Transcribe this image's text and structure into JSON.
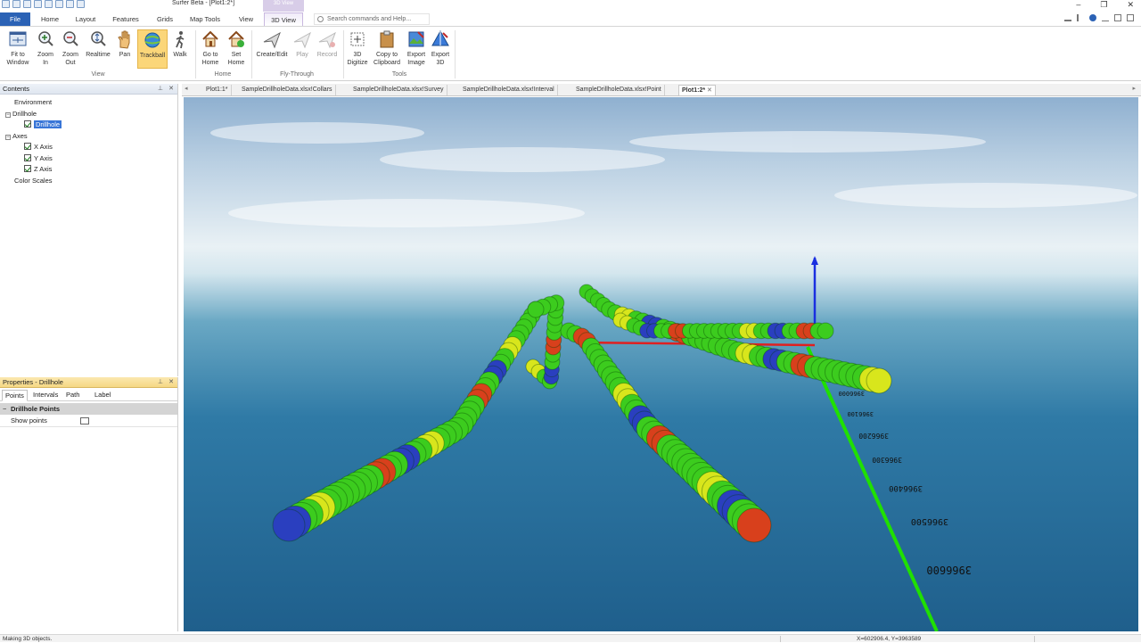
{
  "window": {
    "title": "Surfer Beta - [Plot1:2*]",
    "contextual_tab_header": "3D View"
  },
  "ribbon_tabs": [
    "File",
    "Home",
    "Layout",
    "Features",
    "Grids",
    "Map Tools",
    "View",
    "3D View"
  ],
  "active_tab": "3D View",
  "search": {
    "placeholder": "Search commands and Help..."
  },
  "ribbon": {
    "groups": [
      {
        "label": "View",
        "buttons": [
          "Fit to Window",
          "Zoom In",
          "Zoom Out",
          "Realtime",
          "Pan",
          "Trackball",
          "Walk"
        ]
      },
      {
        "label": "Home",
        "buttons": [
          "Go to Home",
          "Set Home"
        ]
      },
      {
        "label": "Fly-Through",
        "buttons": [
          "Create/Edit",
          "Play",
          "Record"
        ]
      },
      {
        "label": "Tools",
        "buttons": [
          "3D Digitize",
          "Copy to Clipboard",
          "Export Image",
          "Export 3D"
        ]
      }
    ],
    "labels": {
      "fit1": "Fit to",
      "fit2": "Window",
      "zoomin1": "Zoom",
      "zoomin2": "In",
      "zoomout1": "Zoom",
      "zoomout2": "Out",
      "realtime": "Realtime",
      "pan": "Pan",
      "trackball": "Trackball",
      "walk": "Walk",
      "gohome1": "Go to",
      "gohome2": "Home",
      "sethome1": "Set",
      "sethome2": "Home",
      "create": "Create/Edit",
      "play": "Play",
      "record": "Record",
      "dig1": "3D",
      "dig2": "Digitize",
      "copy1": "Copy to",
      "copy2": "Clipboard",
      "expimg1": "Export",
      "expimg2": "Image",
      "exp3d1": "Export",
      "exp3d2": "3D"
    },
    "selected": "Trackball",
    "disabled": [
      "Play",
      "Record"
    ]
  },
  "contents_panel": {
    "title": "Contents",
    "tree": {
      "environment": "Environment",
      "drillhole": "Drillhole",
      "drillhole_child": "Drillhole",
      "axes": "Axes",
      "x_axis": "X Axis",
      "y_axis": "Y Axis",
      "z_axis": "Z Axis",
      "color_scales": "Color Scales"
    }
  },
  "properties_panel": {
    "title": "Properties - Drillhole",
    "tabs": [
      "Points",
      "Intervals",
      "Path",
      "Label"
    ],
    "active_tab": "Points",
    "section": "Drillhole Points",
    "rows": [
      {
        "label": "Show points",
        "checked": false
      }
    ]
  },
  "doc_tabs": [
    "Plot1:1*",
    "SampleDrillholeData.xlsx!Collars",
    "SampleDrillholeData.xlsx!Survey",
    "SampleDrillholeData.xlsx!Interval",
    "SampleDrillholeData.xlsx!Point",
    "Plot1:2*"
  ],
  "active_doc_tab": "Plot1:2*",
  "axis_labels": [
    "3966000",
    "3966100",
    "3966200",
    "3966300",
    "3966400",
    "3966500",
    "3966600"
  ],
  "status": {
    "message": "Making 3D objects.",
    "coords": "X=602906.4, Y=3963589"
  },
  "colors": {
    "file_tab": "#2b62b5",
    "selected_button": "#fbd679",
    "tree_selection": "#3875d7",
    "sky_top": "#a9c3dc",
    "sea": "#1f5f8c",
    "drill_green": "#3ccc1e",
    "drill_yellow": "#d8e61c",
    "drill_blue": "#2a3fbf",
    "drill_red": "#d8401c",
    "axis_green": "#20e000",
    "axis_blue": "#1a2fe0",
    "axis_red": "#e02020"
  }
}
